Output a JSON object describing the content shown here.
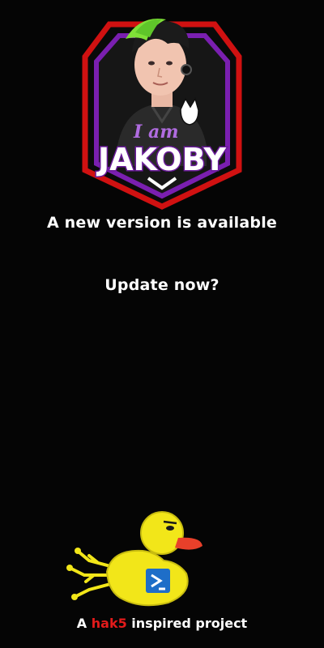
{
  "logo": {
    "line1": "I am",
    "line2": "JAKOBY"
  },
  "message": {
    "headline": "A new version is available",
    "prompt": "Update now?"
  },
  "footer": {
    "prefix": "A",
    "brand": "hak5",
    "suffix": "inspired project"
  },
  "colors": {
    "background": "#050505",
    "text": "#ffffff",
    "logo_red": "#d01111",
    "logo_purple": "#7a1fb0",
    "duck_yellow": "#f2e619",
    "duck_beak": "#e8402a",
    "brand_red": "#e31b1b",
    "powershell_blue": "#1e6ec8"
  },
  "icons": {
    "logo": "avatar-badge-logo",
    "mascot": "rubber-duck-icon",
    "duck_badge": "powershell-icon"
  }
}
